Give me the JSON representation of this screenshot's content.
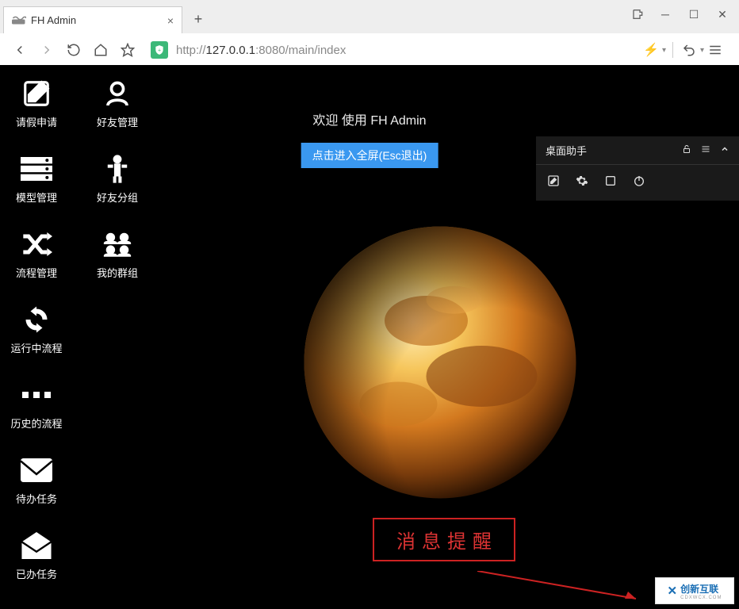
{
  "browser": {
    "tab_title": "FH Admin",
    "new_tab_label": "+",
    "url_host": "127.0.0.1",
    "url_port": ":8080",
    "url_path": "/main/index",
    "url_scheme": "http://"
  },
  "nav": {
    "back": "‹",
    "forward": "›",
    "refresh": "⟳",
    "home": "⌂",
    "favorite": "☆"
  },
  "app": {
    "welcome": "欢迎 使用 FH Admin",
    "fullscreen_btn": "点击进入全屏(Esc退出)",
    "msg_alert": "消息提醒"
  },
  "desktop_items": {
    "row1": [
      {
        "name": "leave-apply",
        "label": "请假申请",
        "icon": "edit"
      },
      {
        "name": "friend-manage",
        "label": "好友管理",
        "icon": "user"
      }
    ],
    "row2": [
      {
        "name": "model-manage",
        "label": "模型管理",
        "icon": "server"
      },
      {
        "name": "friend-group",
        "label": "好友分组",
        "icon": "person"
      }
    ],
    "row3": [
      {
        "name": "flow-manage",
        "label": "流程管理",
        "icon": "shuffle"
      },
      {
        "name": "my-groups",
        "label": "我的群组",
        "icon": "group"
      }
    ],
    "row4": [
      {
        "name": "running-flow",
        "label": "运行中流程",
        "icon": "sync"
      }
    ],
    "row5": [
      {
        "name": "history-flow",
        "label": "历史的流程",
        "icon": "dots"
      }
    ],
    "row6": [
      {
        "name": "todo-tasks",
        "label": "待办任务",
        "icon": "mail"
      }
    ],
    "row7": [
      {
        "name": "done-tasks",
        "label": "已办任务",
        "icon": "open-mail"
      }
    ]
  },
  "assistant": {
    "title": "桌面助手",
    "icons": [
      "edit",
      "gear",
      "window",
      "power"
    ]
  },
  "watermark": {
    "brand": "创新互联",
    "sub": "CDXWCX.COM"
  }
}
